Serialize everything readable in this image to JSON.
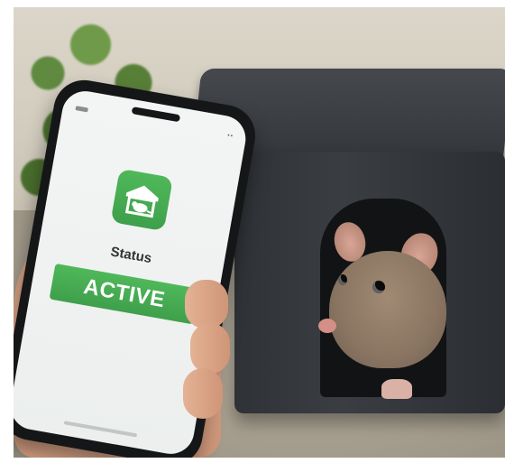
{
  "phone": {
    "screen": {
      "status_bar_right": "••",
      "app_icon": "house-mouse-icon",
      "status_label": "Status",
      "status_value": "ACTIVE"
    }
  },
  "colors": {
    "accent_green": "#4fb85a",
    "box_black": "#2f3236",
    "screen_bg": "#f3f5f4"
  }
}
